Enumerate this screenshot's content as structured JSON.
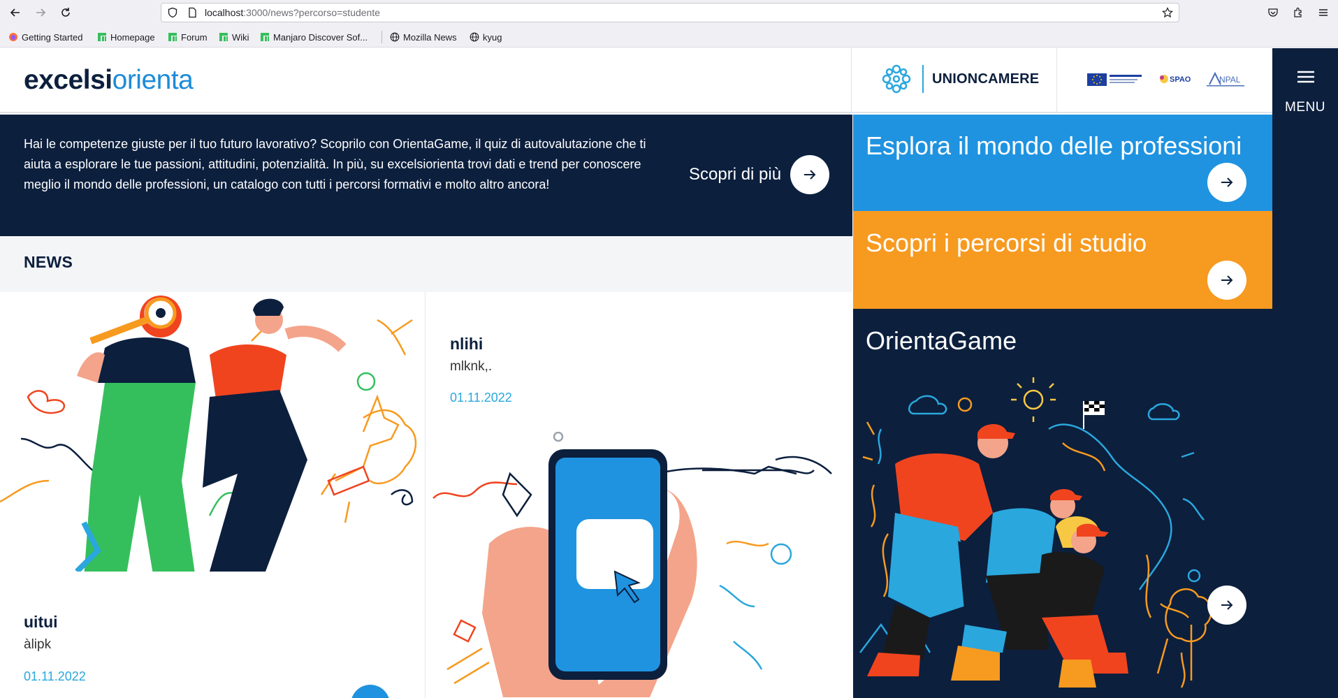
{
  "browser": {
    "url_host": "localhost",
    "url_rest": ":3000/news?percorso=studente",
    "bookmarks": [
      {
        "label": "Getting Started",
        "icon": "firefox-icon"
      },
      {
        "label": "Homepage",
        "icon": "manjaro-icon"
      },
      {
        "label": "Forum",
        "icon": "manjaro-icon"
      },
      {
        "label": "Wiki",
        "icon": "manjaro-icon"
      },
      {
        "label": "Manjaro Discover Sof...",
        "icon": "manjaro-icon"
      },
      {
        "label": "Mozilla News",
        "icon": "globe-icon"
      },
      {
        "label": "kyug",
        "icon": "globe-icon"
      }
    ]
  },
  "header": {
    "logo_part1": "excelsi",
    "logo_part2": "orienta",
    "union_label": "UNIONCAMERE",
    "partners": [
      "UNIONE EUROPEA",
      "SPAO",
      "ANPAL"
    ]
  },
  "menu": {
    "label": "MENU"
  },
  "hero": {
    "text": "Hai le competenze giuste per il tuo futuro lavorativo? Scoprilo con OrientaGame, il quiz di autovalutazione che ti aiuta a esplorare le tue passioni, attitudini, potenzialità. In più, su excelsiorienta trovi dati e trend per conoscere meglio il mondo delle professioni, un catalogo con tutti i percorsi formativi e molto altro ancora!",
    "cta_label": "Scopri di più"
  },
  "tiles": [
    {
      "title": "Esplora il mondo delle professioni",
      "color": "#1f93e0"
    },
    {
      "title": "Scopri i percorsi di studio",
      "color": "#f79a20"
    },
    {
      "title": "OrientaGame",
      "color": "#0c1f3d"
    }
  ],
  "news": {
    "section_title": "NEWS",
    "items": [
      {
        "title": "uitui",
        "subtitle": "àlipk",
        "date": "01.11.2022"
      },
      {
        "title": "nlihi",
        "subtitle": "mlknk,.",
        "date": "01.11.2022"
      }
    ]
  },
  "colors": {
    "navy": "#0c1f3d",
    "blue": "#1f93e0",
    "orange": "#f79a20",
    "accent": "#2aa7dd"
  }
}
